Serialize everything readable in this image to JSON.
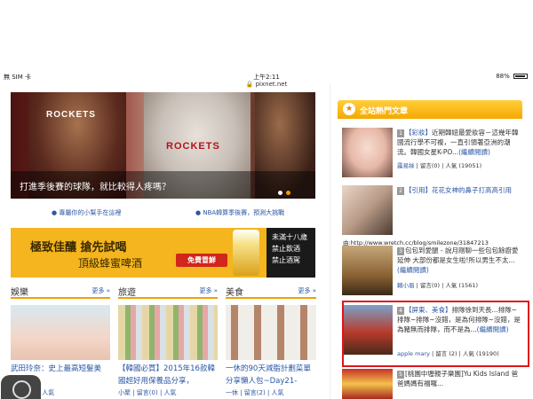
{
  "status_bar": {
    "carrier": "無 SIM 卡",
    "time": "上午2:11",
    "url": "pixnet.net",
    "battery": "88%"
  },
  "hero": {
    "jersey_text": "ROCKETS",
    "caption": "打進季後賽的球隊，就比較得人疼嗎？",
    "dots": 2,
    "active_dot": 1
  },
  "sub_links": [
    "專屬你的小幫手在這裡",
    "NBA韓算季後賽，預測大挑戰"
  ],
  "ad": {
    "slogan1": "極致佳釀 搶先試喝",
    "slogan2": "頂級蜂蜜啤酒",
    "button": "免費冒鮮",
    "warning": [
      "未滿十八歲",
      "禁止飲酒",
      "禁止酒駕"
    ]
  },
  "sections": [
    {
      "title": "娛樂",
      "more": "更多 »",
      "caption": "武田玲奈：史上最高短髮美",
      "meta": "| 留言(0) | 人氣"
    },
    {
      "title": "旅遊",
      "more": "更多 »",
      "caption": "【韓國必買】2015年16款韓國超好用保養品分享，",
      "meta": "小聚 | 留言(0) | 人氣"
    },
    {
      "title": "美食",
      "more": "更多 »",
      "caption": "一休的90天減脂計劃菜單分享懶人包~Day21-Day30...",
      "meta": "一休 | 留言(2) | 人氣"
    }
  ],
  "right_panel": {
    "title": "全站熱門文章",
    "overlay_url": "由:http://www.wretch.cc/blog/smilezone/31847213",
    "items": [
      {
        "num": "1",
        "tag": "【彩妝】",
        "text": "近期韓妞最愛妝容－這幾年韓國流行學不可複，一直引領著亞洲的潮流。韓國女星K-PO...",
        "more": "(繼續閱讀)",
        "author": "露易絲",
        "meta": "| 留言(0) | 人氣 (19051)"
      },
      {
        "num": "2",
        "tag": "【引用】",
        "text": "花花女神的鼻子打高高引用",
        "more": "",
        "author": "",
        "meta": ""
      },
      {
        "num": "3",
        "tag": "",
        "text": "包包到愛腿 - 說月剛聊一些包包餘廚愛延伸 大部份都是女生啦!所以男生不太...",
        "more": "(繼續閱讀)",
        "author": "賴小眉",
        "meta": "| 留言(0) | 人氣 (1561)"
      },
      {
        "num": "4",
        "tag": "【屏東、美食】",
        "text": "排隊徐到天長...排隊~排隊~排隊~沒錯，是為何排隊~沒錯，是為豬無而排隊，而不是為...",
        "more": "(繼續閱讀)",
        "author": "apple mary",
        "meta": "| 留言 (2) | 人氣 (19190)"
      },
      {
        "num": "5",
        "tag": "",
        "text": "[桃園中壢親子樂園]Yu Kids Island 爸爸媽媽有福囉...",
        "more": "",
        "author": "",
        "meta": ""
      }
    ]
  },
  "colors": {
    "accent": "#f5a800",
    "link": "#2b57a4",
    "highlight": "#e0141b"
  }
}
